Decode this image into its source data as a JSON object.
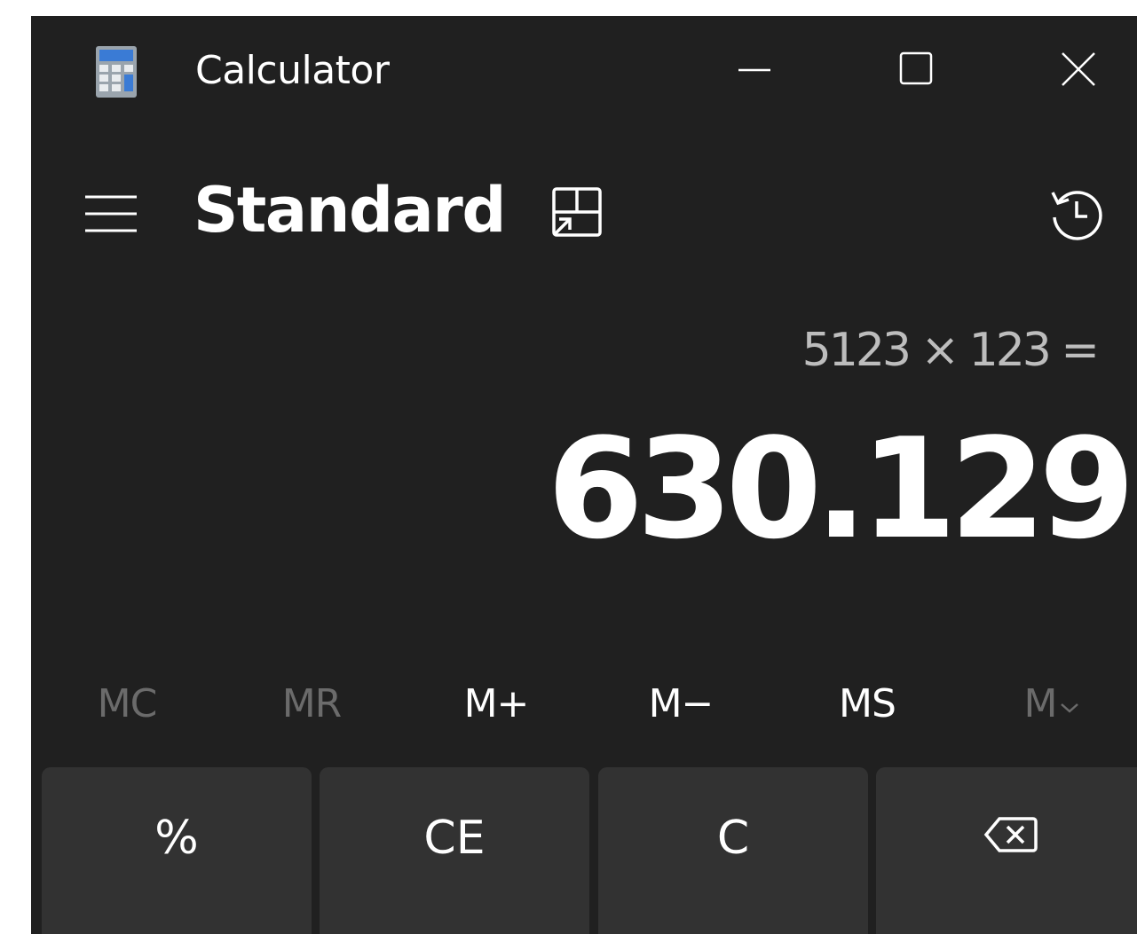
{
  "window": {
    "title": "Calculator",
    "icon": "calculator-app-icon"
  },
  "caption_buttons": {
    "minimize_icon": "minimize-icon",
    "maximize_icon": "maximize-icon",
    "close_icon": "close-icon"
  },
  "header": {
    "menu_icon": "hamburger-menu-icon",
    "mode": "Standard",
    "keep_on_top_icon": "keep-on-top-icon",
    "history_icon": "history-icon"
  },
  "display": {
    "expression": "5123 × 123 =",
    "result": "630.129"
  },
  "memory": {
    "mc": "MC",
    "mr": "MR",
    "m_plus": "M+",
    "m_minus": "M−",
    "ms": "MS",
    "m_list": "M",
    "m_list_icon": "chevron-down-icon"
  },
  "keys": {
    "percent": "%",
    "ce": "CE",
    "c": "C",
    "backspace_icon": "backspace-icon"
  },
  "colors": {
    "window_bg": "#202020",
    "key_bg": "#323232",
    "text_primary": "#ffffff",
    "text_secondary": "#bdbdbd",
    "text_disabled": "#6b6b6b"
  }
}
